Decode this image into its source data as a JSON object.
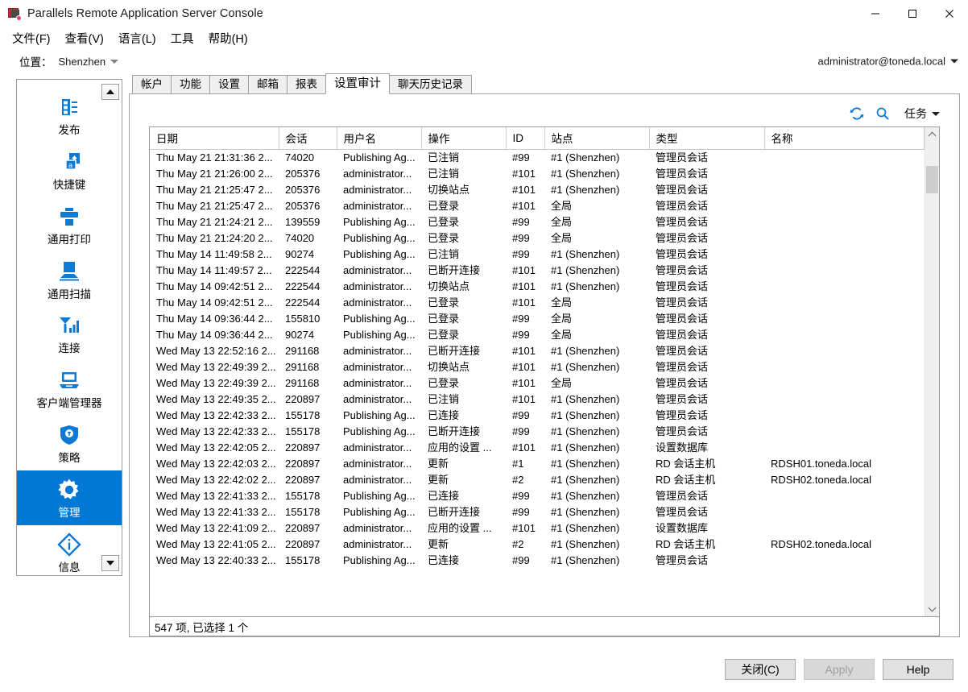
{
  "window": {
    "title": "Parallels Remote Application Server Console",
    "icon": "parallels-app-icon",
    "minimize_label": "—",
    "maximize_label": "□",
    "close_label": "✕"
  },
  "menubar": {
    "items": [
      {
        "label": "文件(F)",
        "name": "menu-file"
      },
      {
        "label": "查看(V)",
        "name": "menu-view"
      },
      {
        "label": "语言(L)",
        "name": "menu-language"
      },
      {
        "label": "工具",
        "name": "menu-tools"
      },
      {
        "label": "帮助(H)",
        "name": "menu-help"
      }
    ]
  },
  "location": {
    "label": "位置：",
    "value": "Shenzhen"
  },
  "user": {
    "account": "administrator@toneda.local"
  },
  "sidebar": {
    "scroll_up": "▲",
    "scroll_down": "▼",
    "items": [
      {
        "label": "发布",
        "icon": "publish-icon",
        "active": false
      },
      {
        "label": "快捷键",
        "icon": "shortcut-icon",
        "active": false
      },
      {
        "label": "通用打印",
        "icon": "printer-icon",
        "active": false
      },
      {
        "label": "通用扫描",
        "icon": "scanner-icon",
        "active": false
      },
      {
        "label": "连接",
        "icon": "connection-signal-icon",
        "active": false
      },
      {
        "label": "客户端管理器",
        "icon": "client-manager-icon",
        "active": false
      },
      {
        "label": "策略",
        "icon": "shield-policy-icon",
        "active": false
      },
      {
        "label": "管理",
        "icon": "gear-icon",
        "active": true
      },
      {
        "label": "信息",
        "icon": "info-diamond-icon",
        "active": false
      },
      {
        "label": "",
        "icon": "monitoring-chart-icon",
        "active": false
      }
    ]
  },
  "tabs": [
    {
      "label": "帐户",
      "name": "tab-accounts",
      "active": false
    },
    {
      "label": "功能",
      "name": "tab-features",
      "active": false
    },
    {
      "label": "设置",
      "name": "tab-settings",
      "active": false
    },
    {
      "label": "邮箱",
      "name": "tab-mailbox",
      "active": false
    },
    {
      "label": "报表",
      "name": "tab-reports",
      "active": false
    },
    {
      "label": "设置审计",
      "name": "tab-settings-audit",
      "active": true
    },
    {
      "label": "聊天历史记录",
      "name": "tab-chat-history",
      "active": false
    }
  ],
  "toolbar": {
    "refresh_icon": "refresh-icon",
    "search_icon": "search-icon",
    "task_label": "任务"
  },
  "table": {
    "headers": [
      "日期",
      "会话",
      "用户名",
      "操作",
      "ID",
      "站点",
      "类型",
      "名称"
    ],
    "rows": [
      [
        "Thu May 21 21:31:36 2...",
        "74020",
        "Publishing Ag...",
        "已注销",
        "#99",
        "#1 (Shenzhen)",
        "管理员会话",
        ""
      ],
      [
        "Thu May 21 21:26:00 2...",
        "205376",
        "administrator...",
        "已注销",
        "#101",
        "#1 (Shenzhen)",
        "管理员会话",
        ""
      ],
      [
        "Thu May 21 21:25:47 2...",
        "205376",
        "administrator...",
        "切换站点",
        "#101",
        "#1 (Shenzhen)",
        "管理员会话",
        ""
      ],
      [
        "Thu May 21 21:25:47 2...",
        "205376",
        "administrator...",
        "已登录",
        "#101",
        "全局",
        "管理员会话",
        ""
      ],
      [
        "Thu May 21 21:24:21 2...",
        "139559",
        "Publishing Ag...",
        "已登录",
        "#99",
        "全局",
        "管理员会话",
        ""
      ],
      [
        "Thu May 21 21:24:20 2...",
        "74020",
        "Publishing Ag...",
        "已登录",
        "#99",
        "全局",
        "管理员会话",
        ""
      ],
      [
        "Thu May 14 11:49:58 2...",
        "90274",
        "Publishing Ag...",
        "已注销",
        "#99",
        "#1 (Shenzhen)",
        "管理员会话",
        ""
      ],
      [
        "Thu May 14 11:49:57 2...",
        "222544",
        "administrator...",
        "已断开连接",
        "#101",
        "#1 (Shenzhen)",
        "管理员会话",
        ""
      ],
      [
        "Thu May 14 09:42:51 2...",
        "222544",
        "administrator...",
        "切换站点",
        "#101",
        "#1 (Shenzhen)",
        "管理员会话",
        ""
      ],
      [
        "Thu May 14 09:42:51 2...",
        "222544",
        "administrator...",
        "已登录",
        "#101",
        "全局",
        "管理员会话",
        ""
      ],
      [
        "Thu May 14 09:36:44 2...",
        "155810",
        "Publishing Ag...",
        "已登录",
        "#99",
        "全局",
        "管理员会话",
        ""
      ],
      [
        "Thu May 14 09:36:44 2...",
        "90274",
        "Publishing Ag...",
        "已登录",
        "#99",
        "全局",
        "管理员会话",
        ""
      ],
      [
        "Wed May 13 22:52:16 2...",
        "291168",
        "administrator...",
        "已断开连接",
        "#101",
        "#1 (Shenzhen)",
        "管理员会话",
        ""
      ],
      [
        "Wed May 13 22:49:39 2...",
        "291168",
        "administrator...",
        "切换站点",
        "#101",
        "#1 (Shenzhen)",
        "管理员会话",
        ""
      ],
      [
        "Wed May 13 22:49:39 2...",
        "291168",
        "administrator...",
        "已登录",
        "#101",
        "全局",
        "管理员会话",
        ""
      ],
      [
        "Wed May 13 22:49:35 2...",
        "220897",
        "administrator...",
        "已注销",
        "#101",
        "#1 (Shenzhen)",
        "管理员会话",
        ""
      ],
      [
        "Wed May 13 22:42:33 2...",
        "155178",
        "Publishing Ag...",
        "已连接",
        "#99",
        "#1 (Shenzhen)",
        "管理员会话",
        ""
      ],
      [
        "Wed May 13 22:42:33 2...",
        "155178",
        "Publishing Ag...",
        "已断开连接",
        "#99",
        "#1 (Shenzhen)",
        "管理员会话",
        ""
      ],
      [
        "Wed May 13 22:42:05 2...",
        "220897",
        "administrator...",
        "应用的设置 ...",
        "#101",
        "#1 (Shenzhen)",
        "设置数据库",
        ""
      ],
      [
        "Wed May 13 22:42:03 2...",
        "220897",
        "administrator...",
        "更新",
        "#1",
        "#1 (Shenzhen)",
        "RD 会话主机",
        "RDSH01.toneda.local"
      ],
      [
        "Wed May 13 22:42:02 2...",
        "220897",
        "administrator...",
        "更新",
        "#2",
        "#1 (Shenzhen)",
        "RD 会话主机",
        "RDSH02.toneda.local"
      ],
      [
        "Wed May 13 22:41:33 2...",
        "155178",
        "Publishing Ag...",
        "已连接",
        "#99",
        "#1 (Shenzhen)",
        "管理员会话",
        ""
      ],
      [
        "Wed May 13 22:41:33 2...",
        "155178",
        "Publishing Ag...",
        "已断开连接",
        "#99",
        "#1 (Shenzhen)",
        "管理员会话",
        ""
      ],
      [
        "Wed May 13 22:41:09 2...",
        "220897",
        "administrator...",
        "应用的设置 ...",
        "#101",
        "#1 (Shenzhen)",
        "设置数据库",
        ""
      ],
      [
        "Wed May 13 22:41:05 2...",
        "220897",
        "administrator...",
        "更新",
        "#2",
        "#1 (Shenzhen)",
        "RD 会话主机",
        "RDSH02.toneda.local"
      ],
      [
        "Wed May 13 22:40:33 2...",
        "155178",
        "Publishing Ag...",
        "已连接",
        "#99",
        "#1 (Shenzhen)",
        "管理员会话",
        ""
      ]
    ]
  },
  "status": {
    "text": "547 项, 已选择 1 个"
  },
  "footer": {
    "close_label": "关闭(C)",
    "apply_label": "Apply",
    "help_label": "Help"
  },
  "colors": {
    "accent": "#0078d4",
    "selection": "#0078d4",
    "header_text": "#000000"
  }
}
